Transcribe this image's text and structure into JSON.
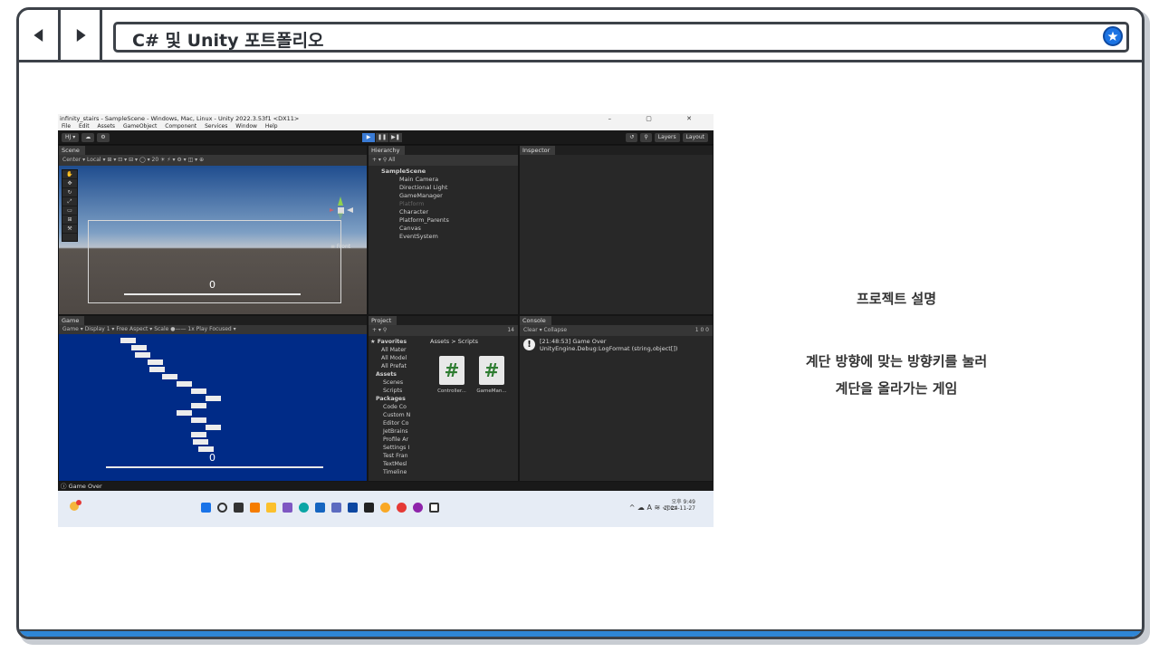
{
  "header": {
    "title": "C# 및 Unity 포트폴리오",
    "back_icon": "back-icon",
    "forward_icon": "forward-icon",
    "star_icon": "star-icon"
  },
  "screenshot": {
    "titlebar": "infinity_stairs - SampleScene - Windows, Mac, Linux - Unity 2022.3.53f1 <DX11>",
    "window_controls": "–  ▢  ✕",
    "menu": [
      "File",
      "Edit",
      "Assets",
      "GameObject",
      "Component",
      "Services",
      "Window",
      "Help"
    ],
    "toolbar": {
      "account": "HJ ▾",
      "layers": "Layers",
      "layout": "Layout"
    },
    "scene": {
      "tab": "Scene",
      "subbar": "Center ▾  Local ▾      ⊞ ▾  ⊡ ▾  ⊟ ▾    ◯ ▾  20    ☀    ⚡ ▾  ⚙ ▾  ◫ ▾  ⊕",
      "score": "0",
      "persp": "≡ Front"
    },
    "hierarchy": {
      "tab": "Hierarchy",
      "search": "All",
      "items": [
        "SampleScene",
        "Main Camera",
        "Directional Light",
        "GameManager",
        "Platform",
        "Character",
        "Platform_Parents",
        "Canvas",
        "EventSystem"
      ]
    },
    "inspector": {
      "tab": "Inspector"
    },
    "game": {
      "tab": "Game",
      "subbar": "Game  ▾   Display 1 ▾   Free Aspect             ▾  Scale ●—— 1x      Play Focused  ▾",
      "score": "0"
    },
    "project": {
      "tab": "Project",
      "count": "14",
      "tree": [
        "★ Favorites",
        "All Mater",
        "All Model",
        "All Prefat",
        "Assets",
        "Scenes",
        "Scripts",
        "Packages",
        "Code Co",
        "Custom N",
        "Editor Co",
        "JetBrains",
        "Profile Ar",
        "Settings I",
        "Test Fran",
        "TextMesl",
        "Timeline"
      ],
      "breadcrumb": "Assets > Scripts",
      "files": [
        "Controller...",
        "GameMan..."
      ]
    },
    "console": {
      "tab": "Console",
      "subbar": "Clear ▾  Collapse",
      "counts": "1   0   0",
      "msg1": "[21:48:53] Game Over",
      "msg2": "UnityEngine.Debug:LogFormat (string,object[])"
    },
    "status": "Game Over",
    "taskbar": {
      "tray": "^  ☁  A  ≋ ◁ ▭",
      "time": "오후 9:49",
      "date": "2024-11-27"
    }
  },
  "description": {
    "title": "프로젝트 설명",
    "line1": "계단 방향에 맞는 방향키를 눌러",
    "line2": "계단을 올라가는 게임"
  },
  "colors": {
    "accent": "#2e86d6",
    "frame": "#3d4249",
    "game_bg": "#002b87"
  }
}
